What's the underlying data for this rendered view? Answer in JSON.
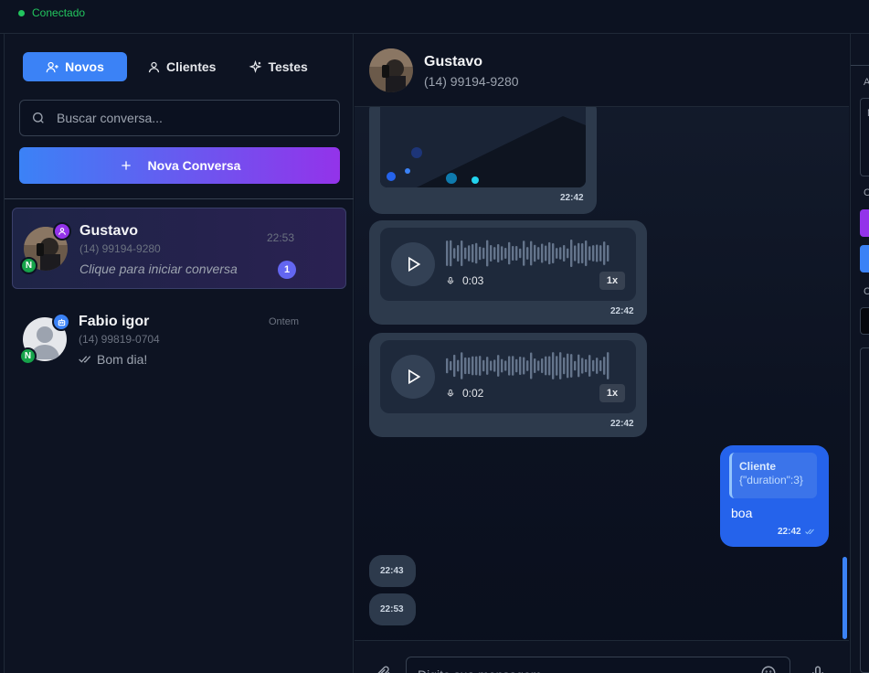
{
  "status": {
    "label": "Conectado"
  },
  "tabs": [
    {
      "label": "Novos",
      "icon": "user-plus-icon"
    },
    {
      "label": "Clientes",
      "icon": "user-icon"
    },
    {
      "label": "Testes",
      "icon": "sparkles-icon"
    }
  ],
  "search": {
    "placeholder": "Buscar conversa..."
  },
  "new_conversation": {
    "label": "Nova Conversa"
  },
  "conversations": [
    {
      "name": "Gustavo",
      "phone": "(14) 99194-9280",
      "last_message": "Clique para iniciar conversa",
      "time": "22:53",
      "unread": "1",
      "tag": "N",
      "type_icon": "user-icon"
    },
    {
      "name": "Fabio igor",
      "phone": "(14) 99819-0704",
      "last_message": "Bom dia!",
      "time": "Ontem",
      "tag": "N",
      "type_icon": "bot-icon"
    }
  ],
  "chat": {
    "name": "Gustavo",
    "phone": "(14) 99194-9280",
    "messages": [
      {
        "kind": "image",
        "time": "22:42"
      },
      {
        "kind": "audio",
        "duration": "0:03",
        "speed": "1x",
        "time": "22:42"
      },
      {
        "kind": "audio",
        "duration": "0:02",
        "speed": "1x",
        "time": "22:42"
      },
      {
        "kind": "outgoing",
        "quote_title": "Cliente",
        "quote_body": "{\"duration\":3}",
        "text": "boa",
        "time": "22:42"
      },
      {
        "kind": "empty",
        "time": "22:43"
      },
      {
        "kind": "empty",
        "time": "22:53"
      }
    ],
    "input_placeholder": "Digite sua mensagem..."
  },
  "right_panel": {
    "letters": [
      "A",
      "M",
      "C",
      "C"
    ]
  },
  "colors": {
    "accent": "#3b82f6",
    "gradient_end": "#9333ea",
    "online": "#22c55e",
    "tag_green": "#16a34a"
  }
}
